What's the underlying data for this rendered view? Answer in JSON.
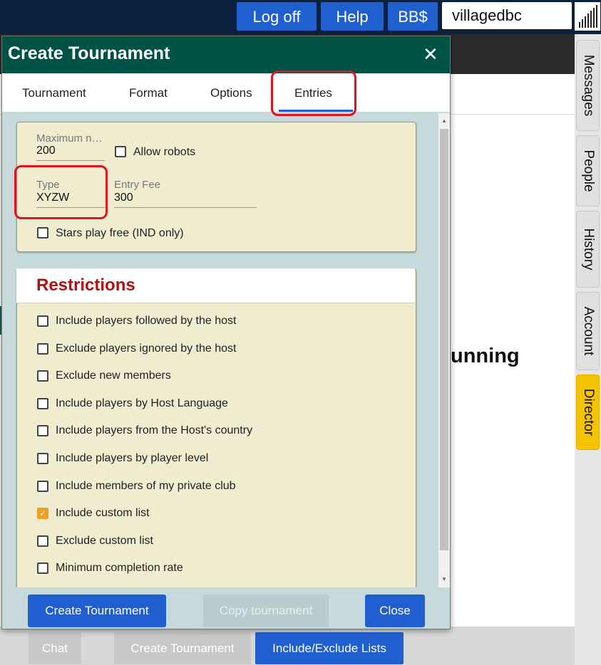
{
  "topbar": {
    "logoff": "Log off",
    "help": "Help",
    "bb": "BB$",
    "username": "villagedbc"
  },
  "background": {
    "running_text": "unning",
    "bottom": {
      "chat": "Chat",
      "create_tournament": "Create Tournament",
      "include_exclude": "Include/Exclude Lists"
    }
  },
  "sidebar": {
    "tabs": [
      "Messages",
      "People",
      "History",
      "Account",
      "Director"
    ],
    "active": "Director"
  },
  "dialog": {
    "title": "Create Tournament",
    "close_icon": "close-icon",
    "tabs": [
      "Tournament",
      "Format",
      "Options",
      "Entries"
    ],
    "active_tab": "Entries",
    "entries": {
      "max_label": "Maximum n…",
      "max_value": "200",
      "allow_robots": "Allow robots",
      "type_label": "Type",
      "type_value": "XYZW",
      "fee_label": "Entry Fee",
      "fee_value": "300",
      "stars_free": "Stars play free (IND only)"
    },
    "restrictions": {
      "title": "Restrictions",
      "items": [
        {
          "label": "Include players followed by the host",
          "checked": false
        },
        {
          "label": "Exclude players ignored by the host",
          "checked": false
        },
        {
          "label": "Exclude new members",
          "checked": false
        },
        {
          "label": "Include players by Host Language",
          "checked": false
        },
        {
          "label": "Include players from the Host's country",
          "checked": false
        },
        {
          "label": "Include players by player level",
          "checked": false
        },
        {
          "label": "Include members of my private club",
          "checked": false
        },
        {
          "label": "Include custom list",
          "checked": true
        },
        {
          "label": "Exclude custom list",
          "checked": false
        },
        {
          "label": "Minimum completion rate",
          "checked": false
        }
      ]
    },
    "footer": {
      "create": "Create Tournament",
      "copy": "Copy tournament",
      "close": "Close"
    }
  },
  "colors": {
    "header": "#005245",
    "accent_blue": "#1f5fcf",
    "highlight_red": "#e0141e",
    "panel": "#efecd0",
    "restrictions_title": "#b31010",
    "director_tab": "#f5c400"
  }
}
